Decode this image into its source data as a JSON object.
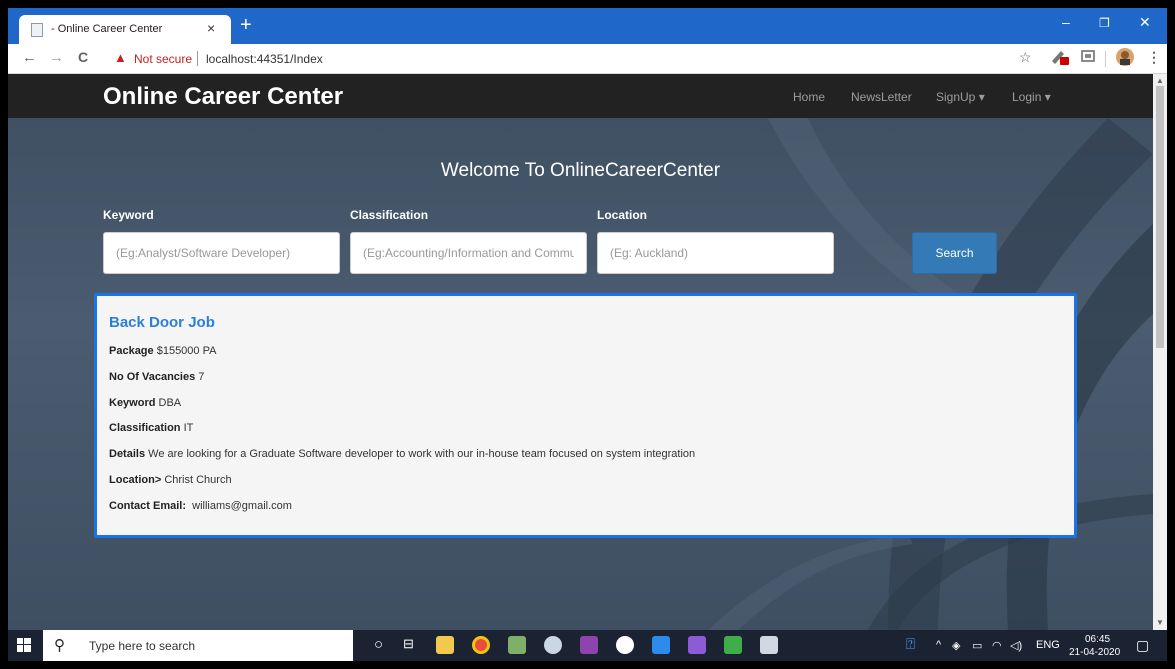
{
  "browser": {
    "tab_title": "- Online Career Center",
    "tab_close": "×",
    "new_tab": "+",
    "win_minimize": "–",
    "win_restore": "❐",
    "win_close": "✕",
    "back": "←",
    "forward": "→",
    "reload": "C",
    "warning_icon": "▲",
    "security_label": "Not secure",
    "url": "localhost:44351/Index",
    "menu": "⋮"
  },
  "site": {
    "brand": "Online Career Center",
    "nav": [
      {
        "label": "Home"
      },
      {
        "label": "NewsLetter"
      },
      {
        "label": "SignUp ▾"
      },
      {
        "label": "Login ▾"
      }
    ]
  },
  "welcome": "Welcome To OnlineCareerCenter",
  "search_form": {
    "keyword_label": "Keyword",
    "keyword_placeholder": "(Eg:Analyst/Software Developer)",
    "classification_label": "Classification",
    "classification_placeholder": "(Eg:Accounting/Information and Communication)",
    "location_label": "Location",
    "location_placeholder": "(Eg: Auckland)",
    "search_button": "Search"
  },
  "job": {
    "title": "Back Door Job",
    "package_label": "Package",
    "package_value": " $155000 PA",
    "vacancies_label": "No Of Vacancies",
    "vacancies_value": " 7",
    "keyword_label": "Keyword",
    "keyword_value": " DBA",
    "classification_label": "Classification",
    "classification_value": " IT",
    "details_label": "Details",
    "details_value": " We are looking for a Graduate Software developer to work with our in-house team focused on system integration",
    "location_label": "Location>",
    "location_value": " Christ Church",
    "contact_label": "Contact Email:",
    "contact_value": "  williams@gmail.com"
  },
  "taskbar": {
    "search_placeholder": "Type here to search",
    "tray_lang": "ENG",
    "time": "06:45",
    "date": "21-04-2020"
  },
  "colors": {
    "tab_strip": "#1f67c9",
    "navbar": "#222222",
    "search_button": "#337ab7",
    "card_border": "#1a73e8",
    "job_title": "#2b7fd8"
  }
}
